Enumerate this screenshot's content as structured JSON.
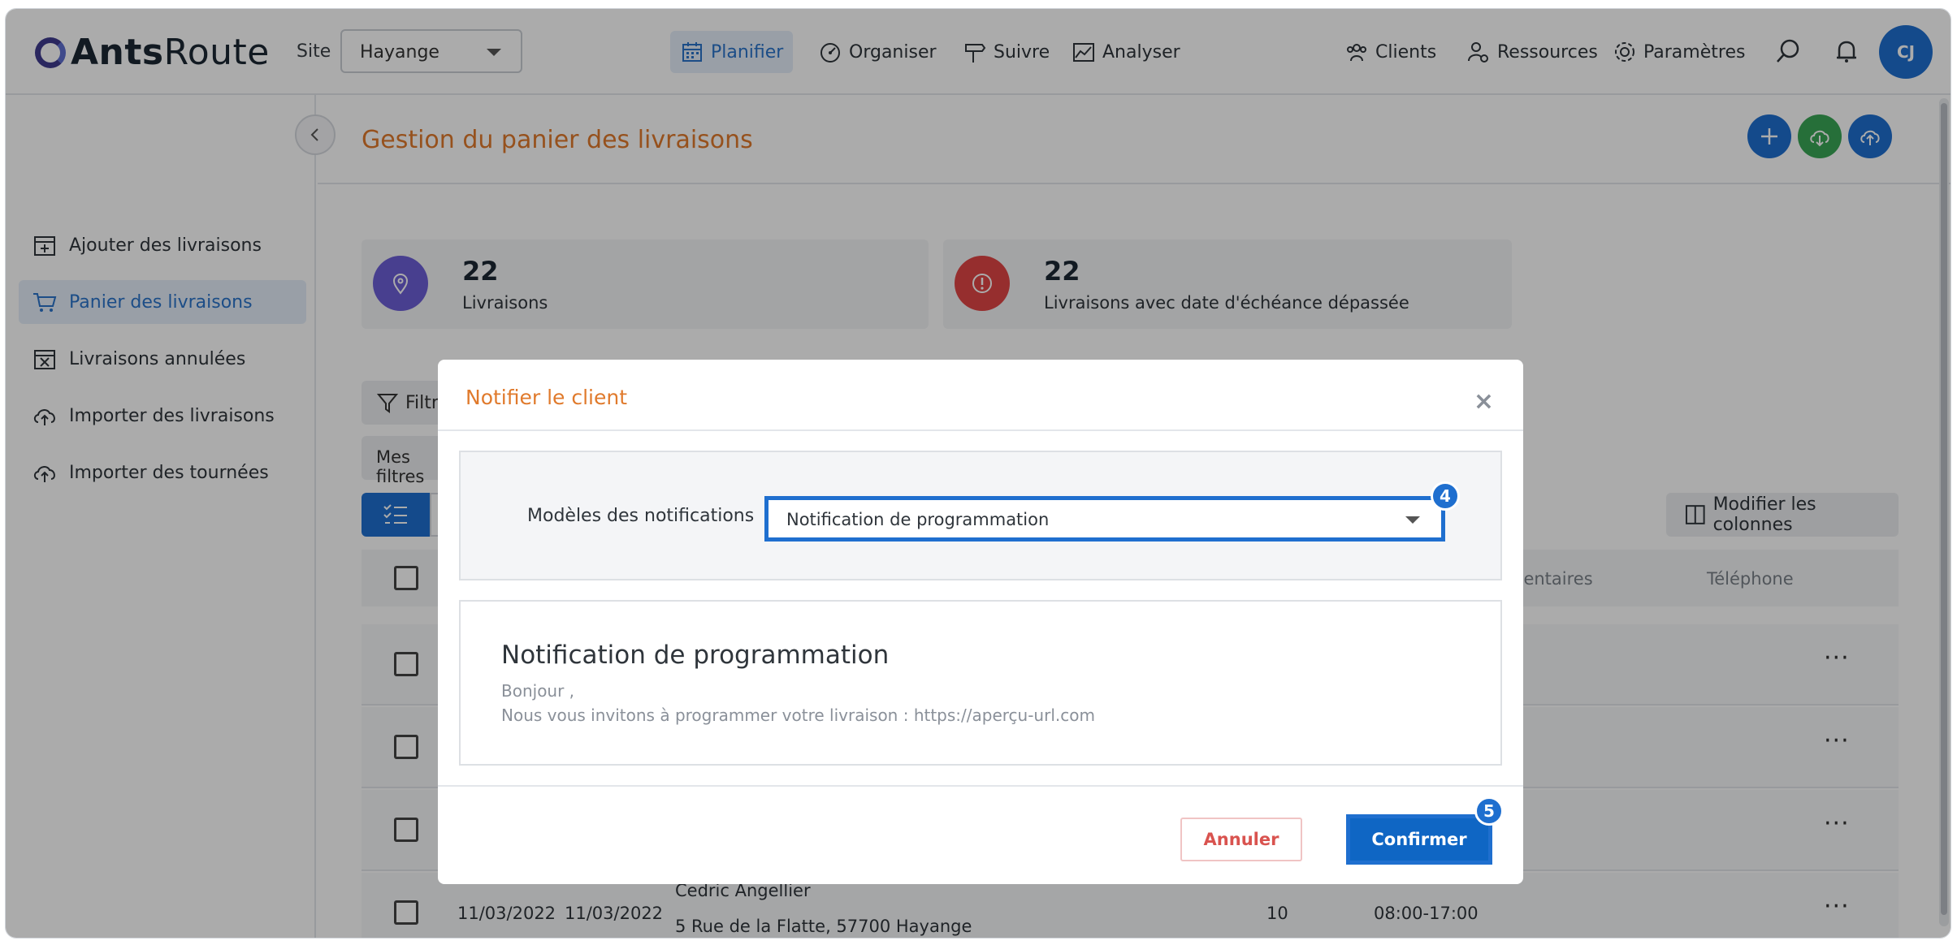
{
  "app": {
    "logo_bold": "Ants",
    "logo_light": "Route"
  },
  "header": {
    "site_label": "Site",
    "site_value": "Hayange",
    "nav": [
      {
        "label": "Planifier",
        "icon": "calendar-icon",
        "active": true
      },
      {
        "label": "Organiser",
        "icon": "gauge-icon"
      },
      {
        "label": "Suivre",
        "icon": "signpost-icon"
      },
      {
        "label": "Analyser",
        "icon": "chart-icon"
      }
    ],
    "right_nav": [
      {
        "label": "Clients",
        "icon": "people-icon"
      },
      {
        "label": "Ressources",
        "icon": "resource-gear-icon"
      },
      {
        "label": "Paramètres",
        "icon": "gear-icon"
      }
    ],
    "avatar_initials": "CJ"
  },
  "sidebar": {
    "items": [
      {
        "label": "Ajouter des livraisons",
        "icon": "calendar-plus-icon"
      },
      {
        "label": "Panier des livraisons",
        "icon": "cart-icon",
        "active": true
      },
      {
        "label": "Livraisons annulées",
        "icon": "calendar-x-icon"
      },
      {
        "label": "Importer des livraisons",
        "icon": "cloud-upload-icon"
      },
      {
        "label": "Importer des tournées",
        "icon": "cloud-upload-icon"
      }
    ]
  },
  "main": {
    "title": "Gestion du panier des livraisons",
    "stats": [
      {
        "value": "22",
        "label": "Livraisons",
        "color": "#6c5ed6"
      },
      {
        "value": "22",
        "label": "Livraisons avec date d'échéance dépassée",
        "color": "#e04545"
      }
    ],
    "filter_label": "Filtre",
    "my_filters_label": "Mes filtres",
    "columns_button": "Modifier les colonnes",
    "visible_headers": {
      "comments": "mentaires",
      "phone": "Téléphone"
    },
    "last_row": {
      "date1": "11/03/2022",
      "date2": "11/03/2022",
      "name": "Cedric Angellier",
      "address": "5 Rue de la Flatte, 57700 Hayange",
      "qty": "10",
      "window": "08:00-17:00"
    }
  },
  "modal": {
    "title": "Notifier le client",
    "template_label": "Modèles des notifications",
    "template_value": "Notification de programmation",
    "step_template": "4",
    "preview_title": "Notification de programmation",
    "preview_line1": "Bonjour ,",
    "preview_line2": "Nous vous invitons à programmer votre livraison :  https://aperçu-url.com",
    "cancel_label": "Annuler",
    "confirm_label": "Confirmer",
    "step_confirm": "5"
  },
  "colors": {
    "accent": "#1f6fcf",
    "title_orange": "#e07a2c",
    "cancel_red": "#d9534f"
  }
}
